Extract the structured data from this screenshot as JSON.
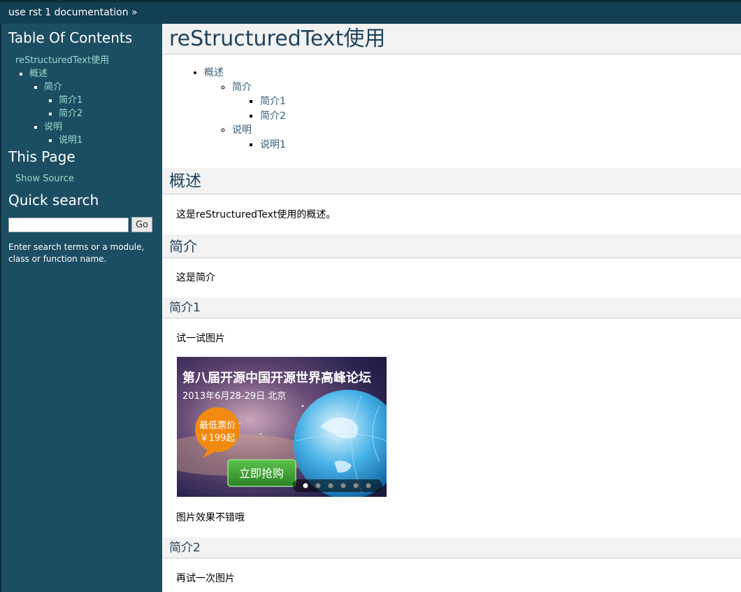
{
  "topbar": {
    "breadcrumb": "use rst 1 documentation »"
  },
  "sidebar": {
    "toc_title": "Table Of Contents",
    "toc": {
      "root": "reStructuredText使用",
      "l1": "概述",
      "l2a": "简介",
      "l3a": "简介1",
      "l3b": "简介2",
      "l2b": "说明",
      "l3c": "说明1"
    },
    "this_page_title": "This Page",
    "show_source": "Show Source",
    "quick_search_title": "Quick search",
    "search_value": "",
    "go_label": "Go",
    "search_hint": "Enter search terms or a module, class or function name."
  },
  "main": {
    "page_title": "reStructuredText使用",
    "toc": {
      "l1": "概述",
      "l2a": "简介",
      "l3a": "简介1",
      "l3b": "简介2",
      "l2b": "说明",
      "l3c": "说明1"
    },
    "sections": {
      "overview_heading": "概述",
      "overview_text": "这是reStructuredText使用的概述。",
      "intro_heading": "简介",
      "intro_text": "这是简介",
      "intro1_heading": "简介1",
      "intro1_text": "试一试图片",
      "after_image_text": "图片效果不错哦",
      "intro2_heading": "简介2",
      "intro2_text": "再试一次图片"
    },
    "banner": {
      "headline": "第八届开源中国开源世界高峰论坛",
      "date": "2013年6月28-29日 北京",
      "price_line1": "最低票价",
      "price_line2": "￥199起",
      "buy_button": "立即抢购",
      "dots_total": 6,
      "dots_active": 1
    }
  },
  "colors": {
    "topbar": "#133f52",
    "sidebar": "#1c4e63",
    "sidebar_link": "#98dbcc",
    "heading_text": "#20435c",
    "heading_bg": "#f2f2f2",
    "link": "#355f7c",
    "banner_orange": "#f28a10",
    "banner_green": "#3a9b2e"
  }
}
